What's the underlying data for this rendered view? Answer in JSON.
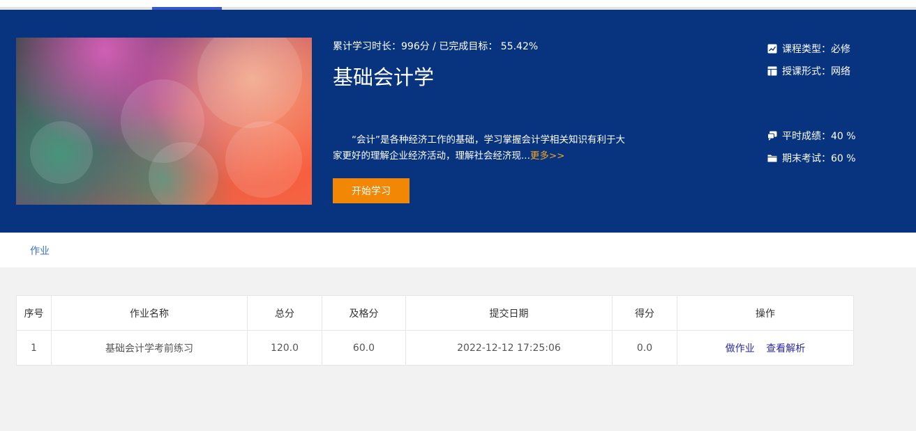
{
  "course": {
    "study_stat": "累计学习时长：996分 / 已完成目标： 55.42%",
    "title": "基础会计学",
    "description": "“会计”是各种经济工作的基础，学习掌握会计学相关知识有利于大家更好的理解企业经济活动，理解社会经济现...",
    "more_label": "更多>>",
    "start_button": "开始学习",
    "meta": {
      "type": "课程类型：必修",
      "format": "授课形式：网络",
      "regular_score": "平时成绩：40 %",
      "final_exam": "期末考试：60 %"
    }
  },
  "tabs": {
    "homework": "作业"
  },
  "table": {
    "headers": {
      "index": "序号",
      "name": "作业名称",
      "total": "总分",
      "passing": "及格分",
      "date": "提交日期",
      "score": "得分",
      "ops": "操作"
    },
    "rows": [
      {
        "index": "1",
        "name": "基础会计学考前练习",
        "total": "120.0",
        "passing": "60.0",
        "date": "2022-12-12 17:25:06",
        "score": "0.0",
        "do_label": "做作业",
        "view_label": "查看解析"
      }
    ]
  },
  "colors": {
    "banner": "#07337f",
    "accent": "#f28706",
    "link": "#3a6fc8"
  }
}
